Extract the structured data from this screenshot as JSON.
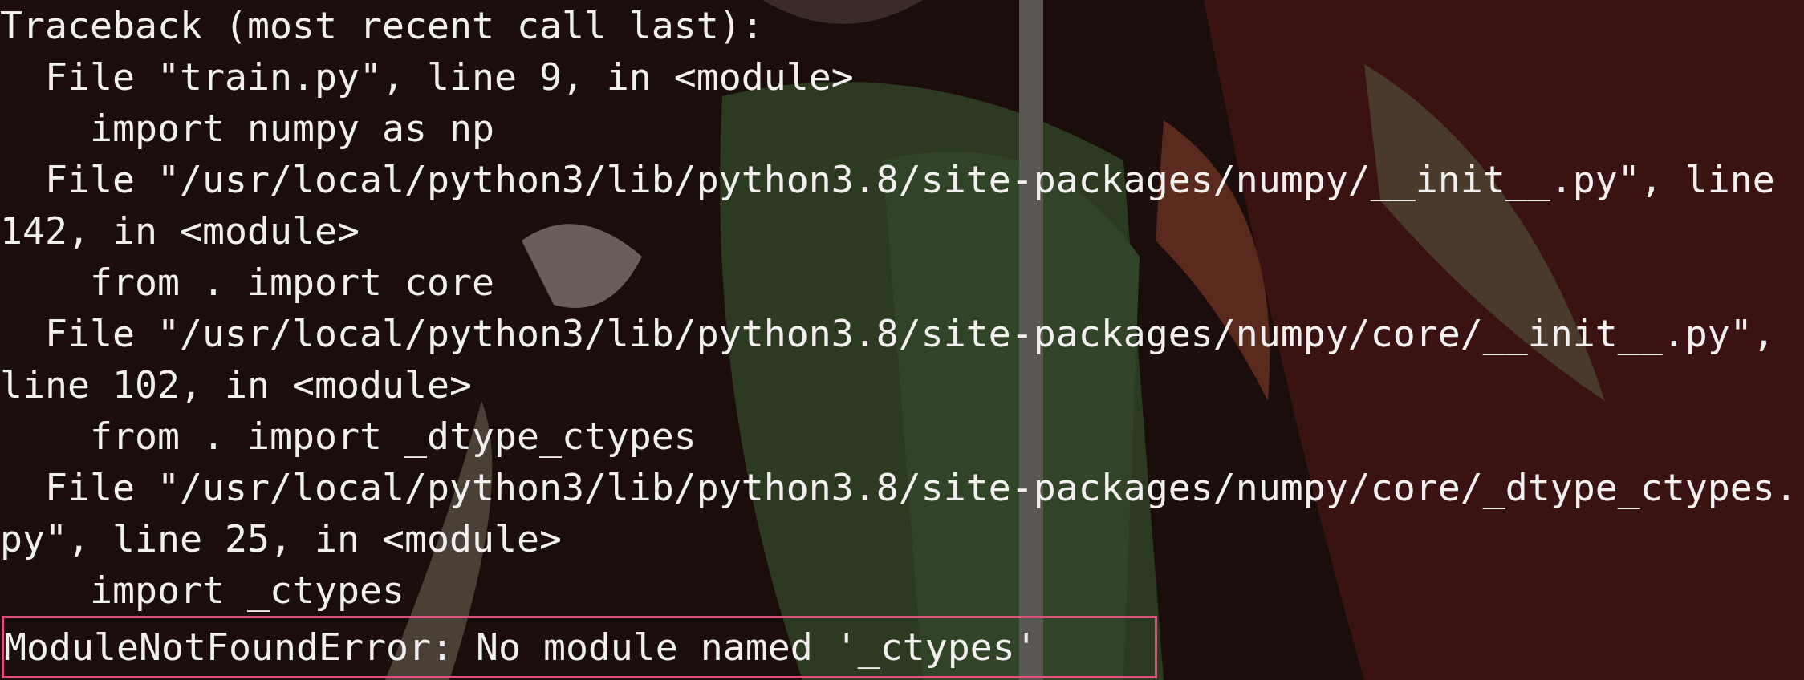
{
  "terminal": {
    "lines": [
      {
        "text": "Traceback (most recent call last):",
        "kind": "output"
      },
      {
        "text": "  File \"train.py\", line 9, in <module>",
        "kind": "output"
      },
      {
        "text": "    import numpy as np",
        "kind": "output"
      },
      {
        "text": "  File \"/usr/local/python3/lib/python3.8/site-packages/numpy/__init__.py\", line",
        "kind": "output"
      },
      {
        "text": "142, in <module>",
        "kind": "output"
      },
      {
        "text": "    from . import core",
        "kind": "output"
      },
      {
        "text": "  File \"/usr/local/python3/lib/python3.8/site-packages/numpy/core/__init__.py\",",
        "kind": "output"
      },
      {
        "text": "line 102, in <module>",
        "kind": "output"
      },
      {
        "text": "    from . import _dtype_ctypes",
        "kind": "output"
      },
      {
        "text": "  File \"/usr/local/python3/lib/python3.8/site-packages/numpy/core/_dtype_ctypes.",
        "kind": "output"
      },
      {
        "text": "py\", line 25, in <module>",
        "kind": "output"
      },
      {
        "text": "    import _ctypes",
        "kind": "output"
      },
      {
        "text": "ModuleNotFoundError: No module named '_ctypes'",
        "kind": "highlighted"
      }
    ]
  }
}
